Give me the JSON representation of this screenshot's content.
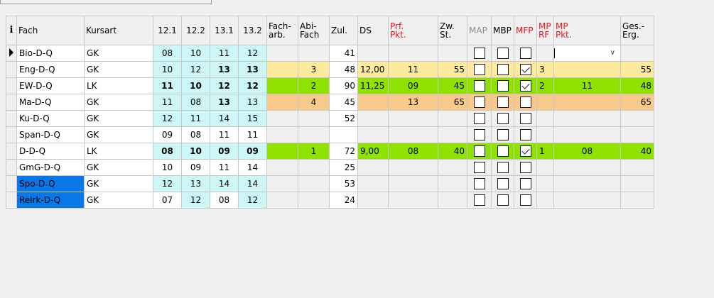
{
  "headers": {
    "fach": "Fach",
    "kursart": "Kursart",
    "s121": "12.1",
    "s122": "12.2",
    "s131": "13.1",
    "s132": "13.2",
    "facharb_1": "Fach-",
    "facharb_2": "arb.",
    "abifach_1": "Abi-",
    "abifach_2": "Fach",
    "zul": "Zul.",
    "ds": "DS",
    "prf_1": "Prf.",
    "prf_2": "Pkt.",
    "zw_1": "Zw.",
    "zw_2": "St.",
    "map": "MAP",
    "mbp": "MBP",
    "mfp": "MFP",
    "mprf_1": "MP",
    "mprf_2": "RF",
    "mppkt_1": "MP",
    "mppkt_2": "Pkt.",
    "ges_1": "Ges.-",
    "ges_2": "Erg."
  },
  "rows": [
    {
      "fach": "Bio-D-Q",
      "kursart": "GK",
      "s121": "08",
      "s122": "10",
      "s131": "11",
      "s132": "12",
      "facharb": "",
      "abifach": "",
      "zul": "41",
      "ds": "",
      "prf": "",
      "zw": "",
      "map": false,
      "mbp": false,
      "mfp": false,
      "mprf": "",
      "mppkt": "",
      "ges": ""
    },
    {
      "fach": "Eng-D-Q",
      "kursart": "GK",
      "s121": "10",
      "s122": "12",
      "s131": "13",
      "s132": "13",
      "facharb": "",
      "abifach": "3",
      "zul": "48",
      "ds": "12,00",
      "prf": "11",
      "zw": "55",
      "map": false,
      "mbp": false,
      "mfp": true,
      "mprf": "3",
      "mppkt": "",
      "ges": "55"
    },
    {
      "fach": "EW-D-Q",
      "kursart": "LK",
      "s121": "11",
      "s122": "10",
      "s131": "12",
      "s132": "12",
      "facharb": "",
      "abifach": "2",
      "zul": "90",
      "ds": "11,25",
      "prf": "09",
      "zw": "45",
      "map": false,
      "mbp": false,
      "mfp": true,
      "mprf": "2",
      "mppkt": "11",
      "ges": "48"
    },
    {
      "fach": "Ma-D-Q",
      "kursart": "GK",
      "s121": "11",
      "s122": "08",
      "s131": "13",
      "s132": "13",
      "facharb": "",
      "abifach": "4",
      "zul": "45",
      "ds": "",
      "prf": "13",
      "zw": "65",
      "map": false,
      "mbp": false,
      "mfp": false,
      "mprf": "",
      "mppkt": "",
      "ges": "65"
    },
    {
      "fach": "Ku-D-Q",
      "kursart": "GK",
      "s121": "12",
      "s122": "11",
      "s131": "14",
      "s132": "15",
      "facharb": "",
      "abifach": "",
      "zul": "52",
      "ds": "",
      "prf": "",
      "zw": "",
      "map": false,
      "mbp": false,
      "mfp": false,
      "mprf": "",
      "mppkt": "",
      "ges": ""
    },
    {
      "fach": "Span-D-Q",
      "kursart": "GK",
      "s121": "09",
      "s122": "08",
      "s131": "11",
      "s132": "11",
      "facharb": "",
      "abifach": "",
      "zul": "",
      "ds": "",
      "prf": "",
      "zw": "",
      "map": false,
      "mbp": false,
      "mfp": false,
      "mprf": "",
      "mppkt": "",
      "ges": ""
    },
    {
      "fach": "D-D-Q",
      "kursart": "LK",
      "s121": "08",
      "s122": "10",
      "s131": "09",
      "s132": "09",
      "facharb": "",
      "abifach": "1",
      "zul": "72",
      "ds": "9,00",
      "prf": "08",
      "zw": "40",
      "map": false,
      "mbp": false,
      "mfp": true,
      "mprf": "1",
      "mppkt": "08",
      "ges": "40"
    },
    {
      "fach": "GmG-D-Q",
      "kursart": "GK",
      "s121": "10",
      "s122": "09",
      "s131": "11",
      "s132": "14",
      "facharb": "",
      "abifach": "",
      "zul": "25",
      "ds": "",
      "prf": "",
      "zw": "",
      "map": false,
      "mbp": false,
      "mfp": false,
      "mprf": "",
      "mppkt": "",
      "ges": ""
    },
    {
      "fach": "Spo-D-Q",
      "kursart": "GK",
      "s121": "12",
      "s122": "13",
      "s131": "14",
      "s132": "14",
      "facharb": "",
      "abifach": "",
      "zul": "53",
      "ds": "",
      "prf": "",
      "zw": "",
      "map": false,
      "mbp": false,
      "mfp": false,
      "mprf": "",
      "mppkt": "",
      "ges": ""
    },
    {
      "fach": "Relrk-D-Q",
      "kursart": "GK",
      "s121": "07",
      "s122": "12",
      "s131": "08",
      "s132": "12",
      "facharb": "",
      "abifach": "",
      "zul": "24",
      "ds": "",
      "prf": "",
      "zw": "",
      "map": false,
      "mbp": false,
      "mfp": false,
      "mprf": "",
      "mppkt": "",
      "ges": ""
    }
  ]
}
